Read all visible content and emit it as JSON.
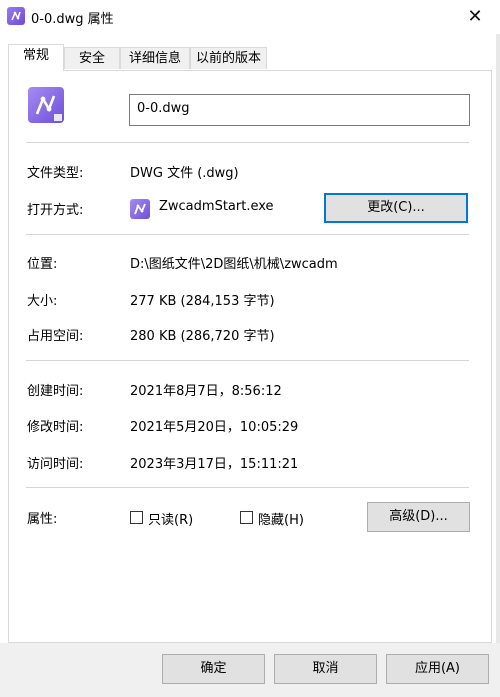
{
  "window": {
    "title": "0-0.dwg 属性",
    "close_glyph": "✕"
  },
  "tabs": [
    "常规",
    "安全",
    "详细信息",
    "以前的版本"
  ],
  "file": {
    "name": "0-0.dwg"
  },
  "type_row": {
    "label": "文件类型:",
    "value": "DWG 文件 (.dwg)"
  },
  "open_with": {
    "label": "打开方式:",
    "app": "ZwcadmStart.exe",
    "change_button": "更改(C)..."
  },
  "location": {
    "label": "位置:",
    "value": "D:\\图纸文件\\2D图纸\\机械\\zwcadm"
  },
  "size": {
    "label": "大小:",
    "value": "277 KB (284,153 字节)"
  },
  "size_on_disk": {
    "label": "占用空间:",
    "value": "280 KB (286,720 字节)"
  },
  "created": {
    "label": "创建时间:",
    "value": "2021年8月7日，8:56:12"
  },
  "modified": {
    "label": "修改时间:",
    "value": "2021年5月20日，10:05:29"
  },
  "accessed": {
    "label": "访问时间:",
    "value": "2023年3月17日，15:11:21"
  },
  "attributes": {
    "label": "属性:",
    "readonly": "只读(R)",
    "hidden": "隐藏(H)",
    "advanced_button": "高级(D)..."
  },
  "footer": {
    "ok": "确定",
    "cancel": "取消",
    "apply": "应用(A)"
  },
  "icons": {
    "file_type": "zwcad-file-icon",
    "app": "zwcad-app-icon",
    "close": "close-icon"
  },
  "colors": {
    "accent": "#0078d7",
    "icon_purple": "#7a5ce0"
  }
}
